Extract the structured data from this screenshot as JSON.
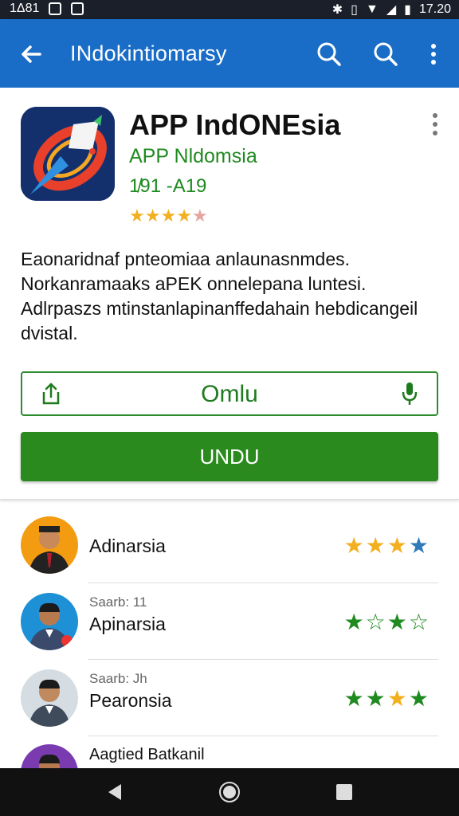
{
  "status": {
    "left_text": "1Δ81",
    "time": "17.20"
  },
  "appbar": {
    "title": "INdokintiomarsy"
  },
  "app": {
    "title": "APP IndONEsia",
    "developer": "APP Nldomsia",
    "version": "1̸91 -A19",
    "rating_stars": 4,
    "icon_color": "#13306d"
  },
  "description": "Eaonaridnaf pnteomiaa anlaunasnmdes.\nNorkanramaaks aPEK onnelepana luntesi.\nAdlrpaszs mtinstanlapinanffedahain hebdicangeil\ndvistal.",
  "actions": {
    "open_label": "Omlu",
    "install_label": "UNDU"
  },
  "reviews": [
    {
      "meta": "",
      "name": "Adinarsia",
      "stars": [
        "#f2b01e",
        "#f2b01e",
        "#f2b01e",
        "#2f7ab8"
      ],
      "avatar_bg": "#f39c12"
    },
    {
      "meta": "Saarb: 11",
      "name": "Apinarsia",
      "stars": [
        "#1f8a1f",
        "hollow",
        "#1f8a1f",
        "hollow"
      ],
      "avatar_bg": "#1e90d6"
    },
    {
      "meta": "Saarb: Jh",
      "name": "Pearonsia",
      "stars": [
        "#1f8a1f",
        "#1f8a1f",
        "#f2b01e",
        "#1f8a1f"
      ],
      "avatar_bg": "#d5dde2"
    },
    {
      "meta": "",
      "name": "Aagtied Batkanil",
      "stars": [],
      "avatar_bg": "#7a3bb0"
    }
  ],
  "colors": {
    "appbar": "#1a6dc6",
    "accent_green": "#2a8a1d",
    "star_gold": "#f2b01e"
  }
}
